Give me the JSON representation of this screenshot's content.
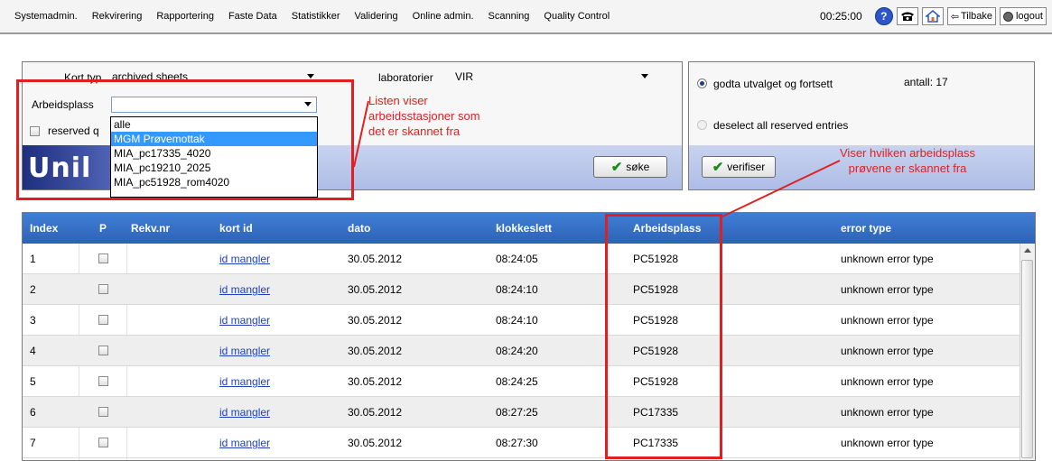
{
  "menu": {
    "items": [
      "Systemadmin.",
      "Rekvirering",
      "Rapportering",
      "Faste Data",
      "Statistikker",
      "Validering",
      "Online admin.",
      "Scanning",
      "Quality Control"
    ],
    "timer": "00:25:00",
    "help_glyph": "?",
    "back_label": "Tilbake",
    "logout_label": "logout"
  },
  "filters": {
    "kort_typ_label": "Kort typ",
    "kort_typ_value": "archived sheets",
    "laboratorier_label": "laboratorier",
    "laboratorier_value": "VIR",
    "arbeidsplass_label": "Arbeidsplass",
    "arbeidsplass_value": "",
    "reserved_label": "reserved q",
    "search_button": "søke",
    "logo_text": "Unil"
  },
  "dropdown": {
    "options": [
      "alle",
      "MGM Prøvemottak",
      "MIA_pc17335_4020",
      "MIA_pc19210_2025",
      "MIA_pc51928_rom4020"
    ],
    "selected_index": 1
  },
  "right_panel": {
    "accept_label": "godta utvalget og fortsett",
    "count_label": "antall: 17",
    "deselect_label": "deselect all reserved entries",
    "verify_button": "verifiser"
  },
  "annotations": {
    "list_note": [
      "Listen viser",
      "arbeidsstasjoner som",
      "det er skannet fra"
    ],
    "workstation_note": [
      "Viser hvilken arbeidsplass",
      "prøvene er skannet fra"
    ]
  },
  "table": {
    "headers": [
      "Index",
      "P",
      "Rekv.nr",
      "kort id",
      "dato",
      "klokkeslett",
      "Arbeidsplass",
      "error type"
    ],
    "rows": [
      {
        "index": "1",
        "rekv": "",
        "kort_id": "id mangler",
        "dato": "30.05.2012",
        "tid": "08:24:05",
        "arbeidsplass": "PC51928",
        "error": "unknown error type"
      },
      {
        "index": "2",
        "rekv": "",
        "kort_id": "id mangler",
        "dato": "30.05.2012",
        "tid": "08:24:10",
        "arbeidsplass": "PC51928",
        "error": "unknown error type"
      },
      {
        "index": "3",
        "rekv": "",
        "kort_id": "id mangler",
        "dato": "30.05.2012",
        "tid": "08:24:10",
        "arbeidsplass": "PC51928",
        "error": "unknown error type"
      },
      {
        "index": "4",
        "rekv": "",
        "kort_id": "id mangler",
        "dato": "30.05.2012",
        "tid": "08:24:20",
        "arbeidsplass": "PC51928",
        "error": "unknown error type"
      },
      {
        "index": "5",
        "rekv": "",
        "kort_id": "id mangler",
        "dato": "30.05.2012",
        "tid": "08:24:25",
        "arbeidsplass": "PC51928",
        "error": "unknown error type"
      },
      {
        "index": "6",
        "rekv": "",
        "kort_id": "id mangler",
        "dato": "30.05.2012",
        "tid": "08:27:25",
        "arbeidsplass": "PC17335",
        "error": "unknown error type"
      },
      {
        "index": "7",
        "rekv": "",
        "kort_id": "id mangler",
        "dato": "30.05.2012",
        "tid": "08:27:30",
        "arbeidsplass": "PC17335",
        "error": "unknown error type"
      }
    ]
  },
  "colors": {
    "header_blue": "#2d62b6",
    "annotation_red": "#e02020",
    "link_blue": "#1f3fbf",
    "selection_blue": "#3399ff"
  }
}
